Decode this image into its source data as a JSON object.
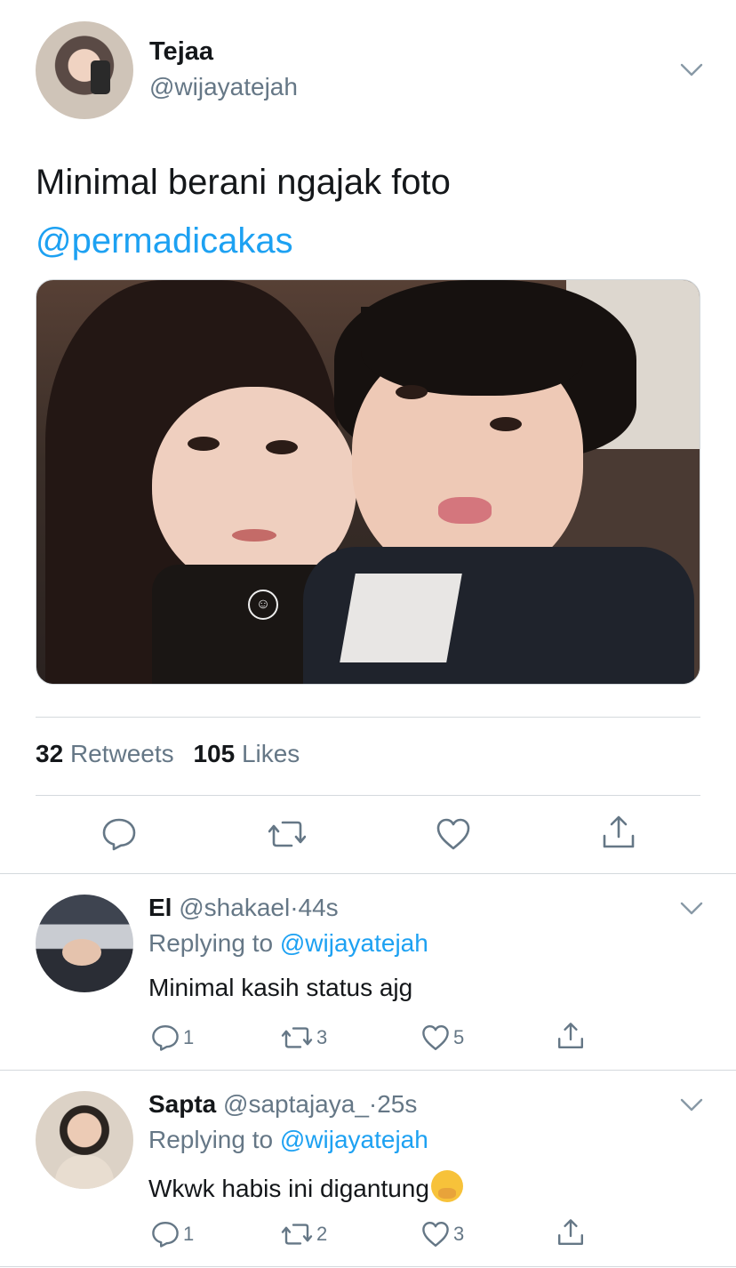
{
  "main_tweet": {
    "display_name": "Tejaa",
    "username": "@wijayatejah",
    "text": "Minimal berani ngajak foto",
    "mention": "@permadicakas",
    "stats": {
      "retweets_count": "32",
      "retweets_label": "Retweets",
      "likes_count": "105",
      "likes_label": "Likes"
    },
    "actions": [
      "reply-icon",
      "retweet-icon",
      "like-icon",
      "share-icon"
    ]
  },
  "replies": [
    {
      "display_name": "El",
      "username": "@shakael",
      "separator": "·",
      "time": "44s",
      "replying_prefix": "Replying to",
      "replying_to": "@wijayatejah",
      "text": "Minimal kasih status ajg",
      "emoji": "",
      "reply_count": "1",
      "retweet_count": "3",
      "like_count": "5"
    },
    {
      "display_name": "Sapta",
      "username": "@saptajaya_",
      "separator": "·",
      "time": "25s",
      "replying_prefix": "Replying to",
      "replying_to": "@wijayatejah",
      "text": "Wkwk habis ini digantung",
      "emoji": "face-with-hand-over-mouth",
      "reply_count": "1",
      "retweet_count": "2",
      "like_count": "3"
    }
  ],
  "colors": {
    "text": "#14171a",
    "secondary": "#657786",
    "link": "#1da1f2",
    "divider": "#d4d9dd"
  }
}
